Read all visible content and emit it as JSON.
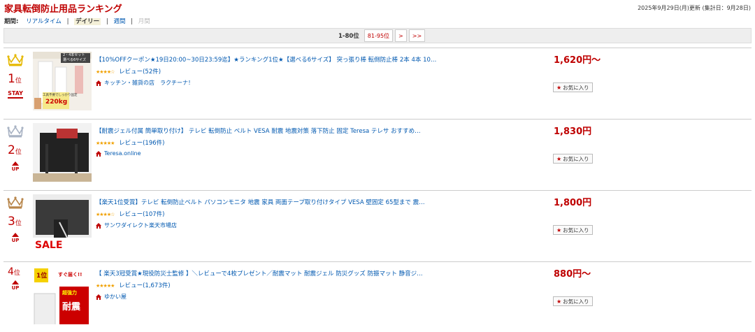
{
  "header": {
    "title": "家具転倒防止用品ランキング",
    "updated": "2025年9月29日(月)更新 (集計日：9月28日)"
  },
  "period": {
    "label": "期間:",
    "realtime": "リアルタイム",
    "daily": "デイリー",
    "weekly": "週間",
    "monthly": "月間",
    "separator": "|"
  },
  "pager": {
    "current": "1-80位",
    "next_page": "81-95位",
    "next": ">",
    "last": ">>"
  },
  "items": [
    {
      "rank": "1",
      "rank_unit": "位",
      "movement": "STAY",
      "title": "【10%OFFクーポン★19日20:00~30日23:59迄】★ランキング1位★【選べる6サイズ】 突っ張り棒 転倒防止棒 2本 4本 10…",
      "stars": "★★★★☆",
      "rating": 4,
      "reviews": "レビュー(52件)",
      "shop": "キッチン・雑貨の店　ラクチーナ！",
      "price": "1,620円～",
      "fav": "お気に入り",
      "thumb_text_1": "2・4本セット",
      "thumb_text_2": "選べる6サイズ",
      "thumb_text_3": "220kg",
      "thumb_text_4": "工具不要でしっかり固定",
      "crown_color": "#e5b800"
    },
    {
      "rank": "2",
      "rank_unit": "位",
      "movement": "UP",
      "title": "【耐震ジェル付属 簡単取り付け】 テレビ 転倒防止 ベルト VESA 耐震 地震対策 落下防止 固定 Teresa テレサ おすすめ…",
      "stars": "★★★★★",
      "rating": 4.5,
      "reviews": "レビュー(196件)",
      "shop": "Teresa.online",
      "price": "1,830円",
      "fav": "お気に入り",
      "crown_color": "#a9b3c4"
    },
    {
      "rank": "3",
      "rank_unit": "位",
      "movement": "UP",
      "title": "【楽天1位受賞】テレビ 転倒防止ベルト パソコンモニタ 地震 家具 両面テープ取り付けタイプ VESA 壁固定 65型まで 震…",
      "stars": "★★★★☆",
      "rating": 4,
      "reviews": "レビュー(107件)",
      "shop": "サンワダイレクト楽天市場店",
      "price": "1,800円",
      "fav": "お気に入り",
      "thumb_sale": "SALE",
      "crown_color": "#b8864b"
    },
    {
      "rank": "4",
      "rank_unit": "位",
      "movement": "UP",
      "title": "【 楽天3冠受賞★現役防災士監修 】＼レビューで4枚プレゼント／耐震マット 耐震ジェル 防災グッズ 防振マット 静音ジ…",
      "stars": "★★★★★",
      "rating": 4.5,
      "reviews": "レビュー(1,673件)",
      "shop": "ゆかい屋",
      "price": "880円～",
      "fav": "お気に入り",
      "thumb_text_1": "1位",
      "thumb_text_2": "すぐ届く!!",
      "thumb_text_3": "超強力",
      "thumb_text_4": "耐震"
    }
  ],
  "colors": {
    "accent": "#bf0000",
    "link": "#0058b0",
    "star": "#f0a000"
  }
}
